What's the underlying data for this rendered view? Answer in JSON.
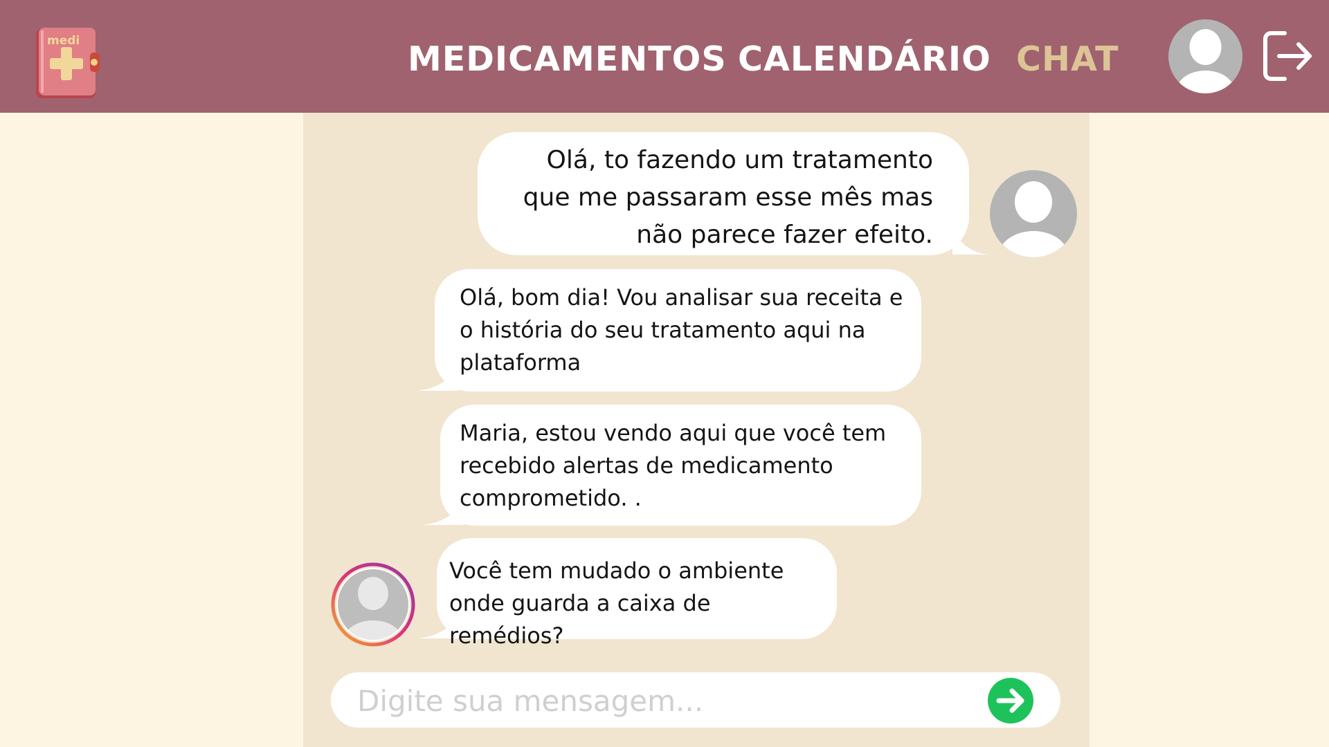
{
  "app": {
    "logo_text": "medi",
    "logo_icon": "first-aid-kit-icon"
  },
  "nav": {
    "items": [
      {
        "label": "MEDICAMENTOS"
      },
      {
        "label": "CALENDÁRIO"
      },
      {
        "label": "CHAT",
        "active": true
      }
    ],
    "profile_icon": "user-avatar-icon",
    "logout_icon": "logout-icon"
  },
  "colors": {
    "header": "#a0626f",
    "page_background": "#fdf5e2",
    "chat_background": "#f1e5cf",
    "active_nav": "#dcc497",
    "send_button": "#1ec25a"
  },
  "messages": [
    {
      "sender": "user",
      "text": "Olá, to fazendo um tratamento que me passaram esse mês mas não parece fazer efeito."
    },
    {
      "sender": "doctor",
      "text": "Olá, bom dia! Vou analisar sua receita e o história do seu tratamento aqui na plataforma"
    },
    {
      "sender": "doctor",
      "text": "Maria, estou vendo aqui que você tem recebido alertas de medicamento comprometido. ."
    },
    {
      "sender": "doctor",
      "text": "Você tem mudado o ambiente onde guarda a caixa de remédios?"
    }
  ],
  "composer": {
    "placeholder": "Digite sua mensagem...",
    "value": "",
    "send_icon": "arrow-right-circle-icon"
  }
}
